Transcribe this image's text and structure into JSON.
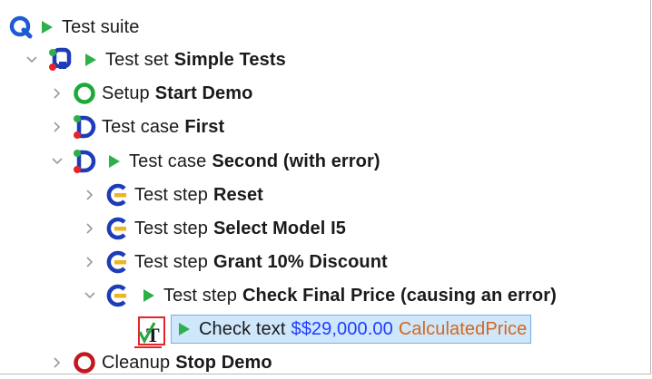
{
  "tree": {
    "suite": {
      "label": "Test suite"
    },
    "set": {
      "prefix": "Test set",
      "name": "Simple Tests"
    },
    "setup": {
      "prefix": "Setup",
      "name": "Start Demo"
    },
    "case_first": {
      "prefix": "Test case",
      "name": "First"
    },
    "case_second": {
      "prefix": "Test case",
      "name": "Second (with error)"
    },
    "step_reset": {
      "prefix": "Test step",
      "name": "Reset"
    },
    "step_select": {
      "prefix": "Test step",
      "name": "Select Model I5"
    },
    "step_grant": {
      "prefix": "Test step",
      "name": "Grant 10% Discount"
    },
    "step_check": {
      "prefix": "Test step",
      "name": "Check Final Price (causing an error)"
    },
    "check_text": {
      "prefix": "Check text",
      "value": "$$29,000.00",
      "component": "CalculatedPrice"
    },
    "cleanup": {
      "prefix": "Cleanup",
      "name": "Stop Demo"
    }
  },
  "icons": {
    "suite": "qf-test-suite-icon",
    "set": "test-set-icon",
    "setup": "setup-icon",
    "case": "test-case-icon",
    "step": "test-step-icon",
    "check": "check-text-icon",
    "cleanup": "cleanup-icon",
    "run": "play-icon",
    "expanded": "chevron-down-icon",
    "collapsed": "chevron-right-icon"
  },
  "colors": {
    "play": "#2db04a",
    "selection_bg": "#cfe7fb",
    "selection_border": "#7aaee0",
    "value_blue": "#1e3cff",
    "component_orange": "#d4661c",
    "setup_green": "#1fa83a",
    "cleanup_red": "#c3181f",
    "error_red": "#e5242b"
  }
}
